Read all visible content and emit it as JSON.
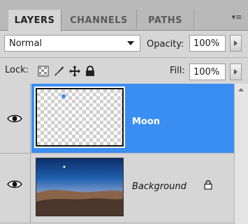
{
  "tabs": [
    {
      "label": "LAYERS",
      "active": true
    },
    {
      "label": "CHANNELS",
      "active": false
    },
    {
      "label": "PATHS",
      "active": false
    }
  ],
  "blend": {
    "mode": "Normal"
  },
  "opacity": {
    "label": "Opacity:",
    "value": "100%"
  },
  "lock": {
    "label": "Lock:"
  },
  "fill": {
    "label": "Fill:",
    "value": "100%"
  },
  "layers": [
    {
      "name": "Moon",
      "visible": true,
      "selected": true,
      "locked": false
    },
    {
      "name": "Background",
      "visible": true,
      "selected": false,
      "locked": true
    }
  ],
  "colors": {
    "selection": "#3b8ef1",
    "panel": "#d6d6d6"
  }
}
